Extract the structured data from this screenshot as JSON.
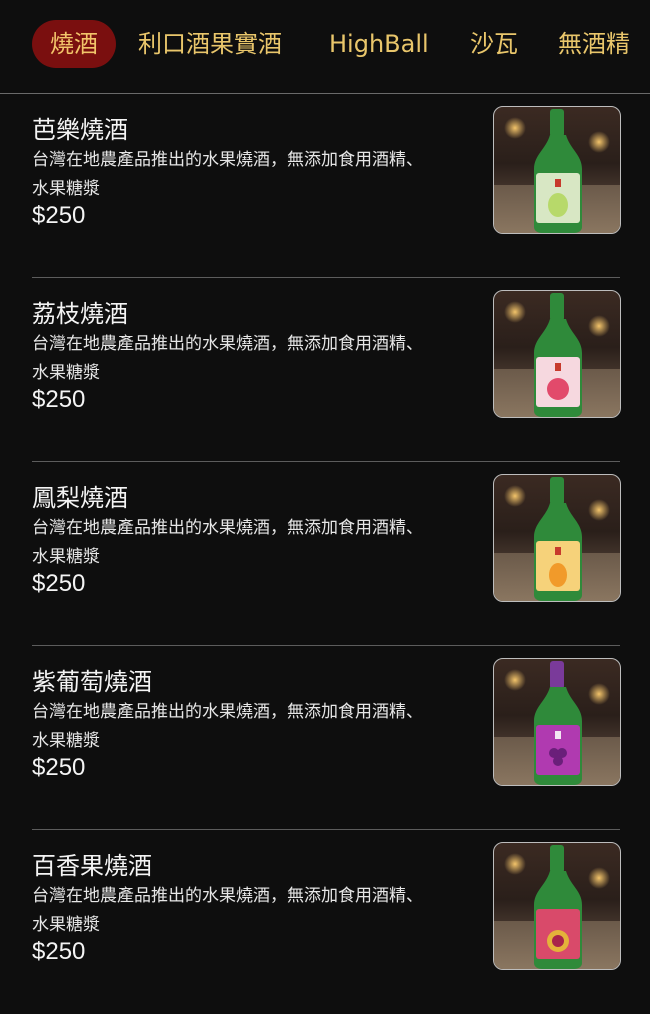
{
  "tabs": [
    {
      "label": "燒酒",
      "active": true
    },
    {
      "label": "利口酒果實酒",
      "active": false
    },
    {
      "label": "HighBall",
      "active": false
    },
    {
      "label": "沙瓦",
      "active": false
    },
    {
      "label": "無酒精",
      "active": false
    }
  ],
  "items": [
    {
      "name": "芭樂燒酒",
      "desc_line1": "台灣在地農產品推出的水果燒酒，無添加食用酒精、",
      "desc_line2": "水果糖漿",
      "price": "$250",
      "label_color": "#d8e7c4",
      "fruit_color": "#b7d96a",
      "thumb_icon": "guava-soju-bottle-icon"
    },
    {
      "name": "荔枝燒酒",
      "desc_line1": "台灣在地農產品推出的水果燒酒，無添加食用酒精、",
      "desc_line2": "水果糖漿",
      "price": "$250",
      "label_color": "#f6d8df",
      "fruit_color": "#e24a6b",
      "thumb_icon": "lychee-soju-bottle-icon"
    },
    {
      "name": "鳳梨燒酒",
      "desc_line1": "台灣在地農產品推出的水果燒酒，無添加食用酒精、",
      "desc_line2": "水果糖漿",
      "price": "$250",
      "label_color": "#f6d27a",
      "fruit_color": "#f19a2a",
      "thumb_icon": "pineapple-soju-bottle-icon"
    },
    {
      "name": "紫葡萄燒酒",
      "desc_line1": "台灣在地農產品推出的水果燒酒，無添加食用酒精、",
      "desc_line2": "水果糖漿",
      "price": "$250",
      "label_color": "#b03ab0",
      "fruit_color": "#6a1f7a",
      "thumb_icon": "grape-soju-bottle-icon"
    },
    {
      "name": "百香果燒酒",
      "desc_line1": "台灣在地農產品推出的水果燒酒，無添加食用酒精、",
      "desc_line2": "水果糖漿",
      "price": "$250",
      "label_color": "#d94a6a",
      "fruit_color": "#e4b23a",
      "thumb_icon": "passionfruit-soju-bottle-icon"
    }
  ],
  "colors": {
    "background": "#0e0e0e",
    "tab_text": "#e9c66b",
    "tab_active_bg": "#7a0f0f",
    "bottle_green": "#2f8a3a"
  }
}
